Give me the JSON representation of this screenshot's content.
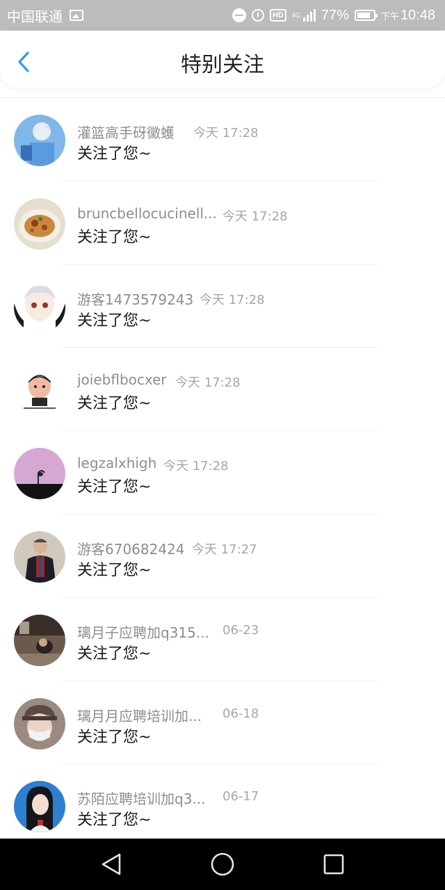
{
  "status_bar": {
    "carrier": "中国联通",
    "network": "4G",
    "battery": "77%",
    "time_prefix": "下午",
    "time": "10:48"
  },
  "header": {
    "title": "特别关注"
  },
  "items": [
    {
      "name": "灌篮高手砑黴蠖",
      "time": "今天 17:28",
      "message": "关注了您~"
    },
    {
      "name": "bruncbellocucinell...",
      "time": "今天 17:28",
      "message": "关注了您~"
    },
    {
      "name": "游客1473579243",
      "time": "今天 17:28",
      "message": "关注了您~"
    },
    {
      "name": "joiebflbocxer",
      "time": "今天 17:28",
      "message": "关注了您~"
    },
    {
      "name": "legzalxhigh",
      "time": "今天 17:28",
      "message": "关注了您~"
    },
    {
      "name": "游客670682424",
      "time": "今天 17:27",
      "message": "关注了您~"
    },
    {
      "name": "璃月子应聘加q315...",
      "time": "06-23",
      "message": "关注了您~"
    },
    {
      "name": "璃月月应聘培训加...",
      "time": "06-18",
      "message": "关注了您~"
    },
    {
      "name": "苏陌应聘培训加q3...",
      "time": "06-17",
      "message": "关注了您~"
    }
  ],
  "colors": {
    "accent": "#2d9cf0",
    "status_bar": "#bcbcbc",
    "name_text": "#8d8d8d",
    "time_text": "#a6a6a6"
  }
}
